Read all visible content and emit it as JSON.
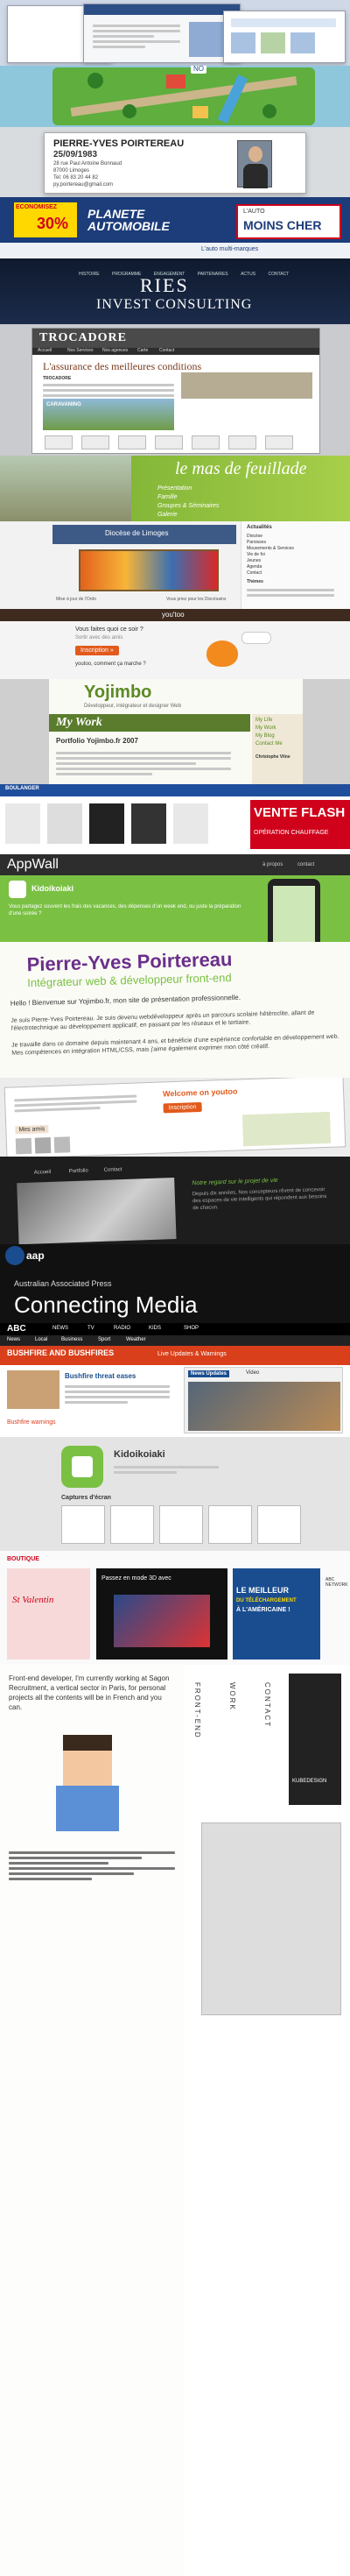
{
  "portfolio": {
    "t1": {
      "header_small": "",
      "badge": "NO"
    },
    "t3": {
      "name": "PIERRE-YVES POIRTEREAU",
      "date": "25/09/1983",
      "address1": "28 rue Paul Antoine Bonnaud",
      "address2": "87000 Limoges",
      "phone": "Tel: 06 83 20 44 82",
      "email": "py.poirtereau@gmail.com"
    },
    "t4": {
      "badge_top": "ECONOMISEZ",
      "badge_pct": "30%",
      "logo": "PLANETE AUTOMOBILE",
      "promo_top": "L'AUTO",
      "promo_big": "MOINS CHER",
      "sub_promo": "L'auto multi-marques"
    },
    "t5": {
      "nav": [
        "HISTOIRE",
        "PROGRAMME",
        "ENGAGEMENT",
        "PARTENAIRES",
        "ACTUS",
        "CONTACT"
      ],
      "logo_top": "RIES",
      "logo_bottom": "INVEST CONSULTING"
    },
    "t6": {
      "brand": "TROCADORE",
      "tagline": "L'assurance des meilleures conditions",
      "nav": [
        "Accueil",
        "Nos Services",
        "Nos agences",
        "Carte",
        "Contact"
      ],
      "side_title": "CARAVANING",
      "body_lead": "TROCADORE"
    },
    "t7": {
      "logo_script": "le mas de feuillade",
      "menu": [
        "Présentation",
        "Famille",
        "Groupes & Séminaires",
        "Galerie"
      ]
    },
    "t8": {
      "banner": "Diocèse de Limoges",
      "side_title": "Actualités",
      "side_items": [
        "Actualités",
        "Diocèse",
        "Paroisses",
        "Mouvements & Services",
        "Vie de foi",
        "Jeunes",
        "Agenda",
        "Contact"
      ],
      "side_sub": "Thèmes",
      "footer_left": "Mise à jour de l'Ordo",
      "footer_right": "Vous priez pour les Diocèsains"
    },
    "t9": {
      "logo": "you'too",
      "q1": "Vous faites quoi ce soir ?",
      "q1_sub": "Sortir avec des amis",
      "button": "Inscription »",
      "q2": "youtoo, comment ça marche ?"
    },
    "t10": {
      "logo": "Yojimbo",
      "tagline": "Développeur, intégrateur et designer Web",
      "section": "My Work",
      "portfolio_title": "Portfolio Yojimbo.fr 2007",
      "side_links": [
        "My Life",
        "My Work",
        "My Blog",
        "Contact Me"
      ],
      "side_heading": "Christophe Vilne"
    },
    "t11": {
      "badge_top": "BOULANGER",
      "flash": "VENTE FLASH",
      "flash_sub": "OPÉRATION CHAUFFAGE"
    },
    "t12": {
      "title": "AppWall",
      "nav": [
        "à propos",
        "contact"
      ],
      "app_name": "Kidoikoiaki",
      "desc": "Vous partagez souvent les frais des vacances, des dépenses d'un week end, ou juste la préparation d'une soirée ?"
    },
    "t13": {
      "name": "Pierre-Yves Poirtereau",
      "role": "Intégrateur web & développeur front-end",
      "greeting": "Hello ! Bienvenue sur Yojimbo.fr, mon site de présentation professionnelle.",
      "line2": "Je suis Pierre-Yves Poirtereau. Je suis devenu webdéveloppeur après un parcours scolaire hétéroclite, allant de l'électrotechnique au développement applicatif, en passant par les réseaux et le tertiaire.",
      "line3": "Je travaille dans ce domaine depuis maintenant 4 ans, et bénéficie d'une expérience confortable en développement web. Mes compétences en intégration HTML/CSS, mais j'aime également exprimer mon côté créatif."
    },
    "t14": {
      "title": "Welcome on youtoo",
      "button": "Inscription",
      "tab": "Mes amis"
    },
    "t15": {
      "nav": [
        "Accueil",
        "Portfolio",
        "Contact"
      ],
      "heading": "Notre regard sur le projet de vie",
      "text": "Depuis dix années, Nos concepteurs rêvent de concevoir des espaces de vie intelligents qui répondent aux besoins de chacun."
    },
    "t16": {
      "logo": "aap",
      "company": "Australian Associated Press",
      "headline": "Connecting Media"
    },
    "t17": {
      "logo": "ABC",
      "nav": [
        "NEWS",
        "TV",
        "RADIO",
        "KIDS",
        "SHOP"
      ],
      "sub_nav": [
        "News",
        "Local",
        "Business",
        "Sport",
        "Weather"
      ],
      "headline": "BUSHFIRE AND BUSHFIRES",
      "sub_headline": "Live Updates & Warnings",
      "story": "Bushfire threat eases",
      "tab_video": "News Updates",
      "tab_video2": "Video",
      "topic": "Bushfire warnings"
    },
    "t18": {
      "app_name": "Kidoikoiaki",
      "section": "Captures d'écran"
    },
    "t19": {
      "logo": "BOUTIQUE",
      "promo_left": "St Valentin",
      "promo_mid": "Passez en mode 3D avec",
      "promo_right_1": "LE MEILLEUR",
      "promo_right_2": "DU TÉLÉCHARGEMENT",
      "promo_right_3": "À L'AMÉRICAINE !",
      "side": "ABC NETWORK"
    },
    "t20": {
      "left_text": "Front-end developer, I'm currently working at Sagon Recruitment, a vertical sector in Paris, for personal projects all the contents will be in French and you can.",
      "labels": [
        "FRONT-END",
        "WORK",
        "CONTACT"
      ],
      "badge": "KUBEDESIGN"
    },
    "colors": {
      "accent_green": "#7ac143",
      "accent_purple": "#6b2f8a",
      "accent_blue": "#1a4d8f",
      "danger_red": "#d0021b",
      "warning_yellow": "#ffd800"
    }
  }
}
